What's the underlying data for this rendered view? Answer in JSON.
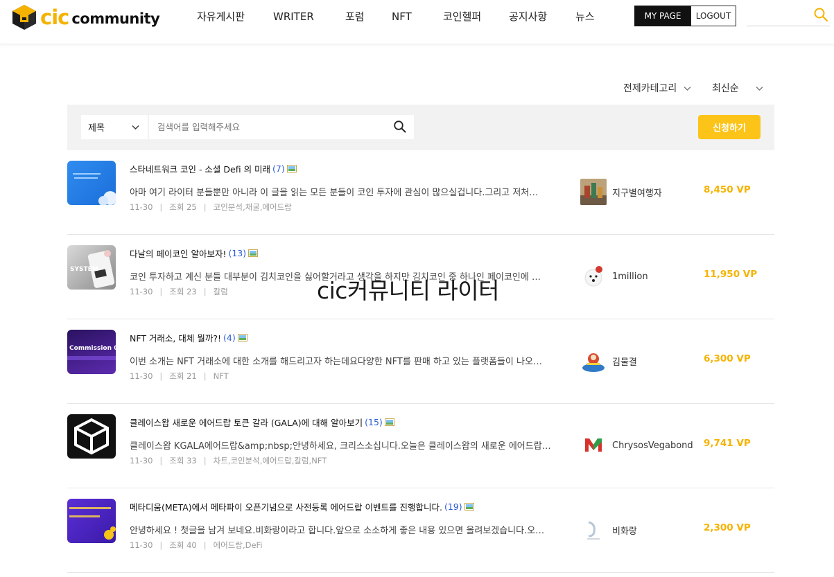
{
  "brand": {
    "logo_main": "cic",
    "logo_sub": "community"
  },
  "nav": [
    {
      "label": "자유게시판"
    },
    {
      "label": "WRITER"
    },
    {
      "label": "포럼"
    },
    {
      "label": "NFT"
    },
    {
      "label": "코인헬퍼"
    },
    {
      "label": "공지사항"
    },
    {
      "label": "뉴스"
    }
  ],
  "account": {
    "mypage_label": "MY PAGE",
    "logout_label": "LOGOUT"
  },
  "sort": {
    "category_label": "전제카테고리",
    "order_label": "최신순"
  },
  "search": {
    "field_label": "제목",
    "placeholder": "검색어를 입력해주세요",
    "apply_label": "신청하기"
  },
  "overlay_text": "cic커뮤니티 라이터",
  "colors": {
    "accent": "#fcc419",
    "vp": "#f5b301",
    "comment_count": "#2a5bd7"
  },
  "posts": [
    {
      "title": "스타네트워크 코인 - 소셜 Defi 의 미래",
      "comments": "(7)",
      "excerpt": "아마 여기 라이터 분들뿐만 아니라 이 글을 읽는 모든 분들이 코인 투자에 관심이 많으실겁니다.그리고 저처…",
      "date": "11-30",
      "views": "조회 25",
      "tags": "코인분석,채굴,에어드랍",
      "author": "지구별여행자",
      "vp": "8,450 VP",
      "thumb_icon": "star-network-thumbnail",
      "thumb_text": "스타 네트워크\n수강 Defi 10%"
    },
    {
      "title": "다날의 페이코인 알아보자!",
      "comments": "(13)",
      "excerpt": "코인 투자하고 계신 분들 대부분이 김치코인을 싫어할거라고 생각을 하지만 김치코인 중 하나인 페이코인에 …",
      "date": "11-30",
      "views": "조회 23",
      "tags": "칼럼",
      "author": "1million",
      "vp": "11,950 VP",
      "thumb_icon": "paycoin-thumbnail",
      "thumb_text": "SYSTEM"
    },
    {
      "title": "NFT 거래소, 대체 뭘까?!",
      "comments": "(4)",
      "excerpt": "이번 소개는 NFT 거래소에 대한 소개를 해드리고자 하는데요다양한 NFT를 판매 하고 있는 플랫폼들이 나오…",
      "date": "11-30",
      "views": "조회 21",
      "tags": "NFT",
      "author": "김물결",
      "vp": "6,300 VP",
      "thumb_icon": "nft-commission-thumbnail",
      "thumb_text": "Commission 0%"
    },
    {
      "title": "클레이스왑 새로운 에어드랍 토큰 갈라 (GALA)에 대해 알아보기",
      "comments": "(15)",
      "excerpt": "클레이스왑 KGALA에어드랍&amp;nbsp;안녕하세요, 크리스소십니다.오늘은 클레이스왑의 새로운 에어드랍…",
      "date": "11-30",
      "views": "조회 33",
      "tags": "차트,코인분석,에어드랍,칼럼,NFT",
      "author": "ChrysosVegabond",
      "vp": "9,741 VP",
      "thumb_icon": "gala-logo-thumbnail",
      "thumb_text": ""
    },
    {
      "title": "메타디움(META)에서 메타파이 오픈기념으로 사전등록 에어드랍 이벤트를 진행합니다.",
      "comments": "(19)",
      "excerpt": "안녕하세요 ! 첫글을 남겨 보네요.비화랑이라고 합니다.앞으로 소소하게 좋은 내용 있으면 올려보겠습니다.오…",
      "date": "11-30",
      "views": "조회 40",
      "tags": "에어드랍,DeFi",
      "author": "비화랑",
      "vp": "2,300 VP",
      "thumb_icon": "metadium-event-thumbnail",
      "thumb_text": "등록만 해도 55 META 지급\n한데이로 NFT 받자!"
    }
  ]
}
